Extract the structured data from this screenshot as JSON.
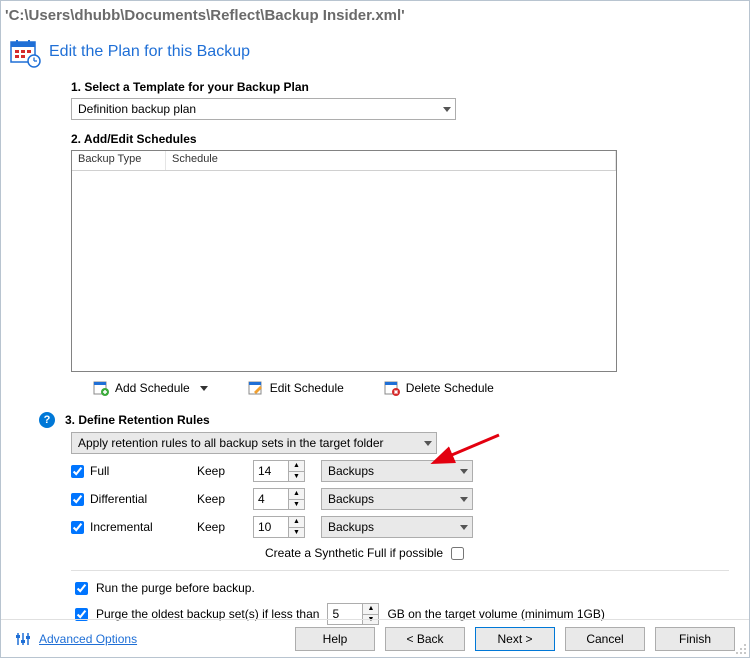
{
  "window": {
    "title": "'C:\\Users\\dhubb\\Documents\\Reflect\\Backup Insider.xml'"
  },
  "header": {
    "title": "Edit the Plan for this Backup"
  },
  "section1": {
    "label": "1. Select a Template for your Backup Plan",
    "template_selected": "Definition backup plan"
  },
  "section2": {
    "label": "2. Add/Edit Schedules",
    "columns": {
      "c1": "Backup Type",
      "c2": "Schedule"
    },
    "toolbar": {
      "add": "Add Schedule",
      "edit": "Edit Schedule",
      "del": "Delete Schedule"
    }
  },
  "section3": {
    "label": "3. Define Retention Rules",
    "scope_selected": "Apply retention rules to all backup sets in the target folder",
    "keep_label": "Keep",
    "rows": {
      "full": {
        "label": "Full",
        "value": "14",
        "unit": "Backups"
      },
      "diff": {
        "label": "Differential",
        "value": "4",
        "unit": "Backups"
      },
      "incr": {
        "label": "Incremental",
        "value": "10",
        "unit": "Backups"
      }
    },
    "synthetic_label": "Create a Synthetic Full if possible"
  },
  "purge": {
    "run_before": "Run the purge before backup.",
    "oldest_prefix": "Purge the oldest backup set(s) if less than",
    "oldest_value": "5",
    "oldest_suffix": "GB on the target volume (minimum 1GB)"
  },
  "footer": {
    "advanced": "Advanced Options",
    "help": "Help",
    "back": "< Back",
    "next": "Next >",
    "cancel": "Cancel",
    "finish": "Finish"
  }
}
